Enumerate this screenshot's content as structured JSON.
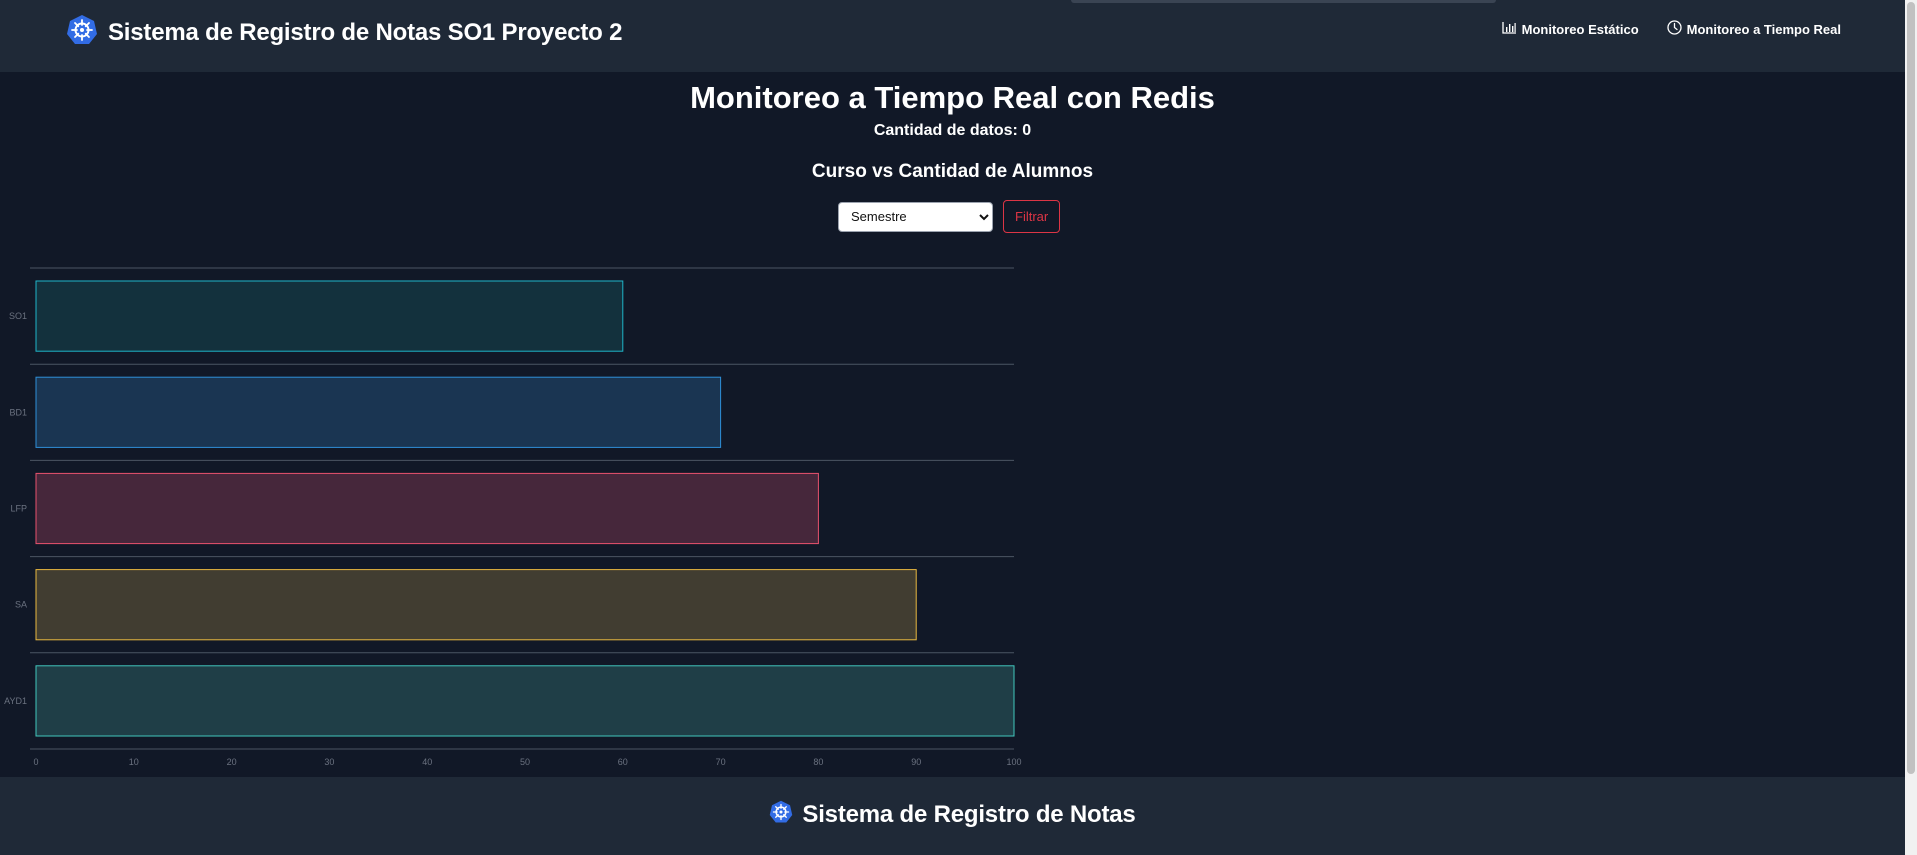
{
  "header": {
    "brand_icon": "kubernetes-helm-icon",
    "title": "Sistema de Registro de Notas SO1 Proyecto 2",
    "nav": [
      {
        "icon": "bar-chart-icon",
        "label": "Monitoreo Estático"
      },
      {
        "icon": "clock-icon",
        "label": "Monitoreo a Tiempo Real"
      }
    ]
  },
  "main": {
    "title": "Monitoreo a Tiempo Real con Redis",
    "data_count": "Cantidad de datos: 0",
    "chart_title": "Curso vs Cantidad de Alumnos",
    "filter": {
      "select_value": "Semestre",
      "button_label": "Filtrar"
    }
  },
  "chart_data": {
    "type": "bar",
    "orientation": "horizontal",
    "categories": [
      "SO1",
      "BD1",
      "LFP",
      "SA",
      "AYD1"
    ],
    "values": [
      60,
      70,
      80,
      90,
      100
    ],
    "xlim": [
      0,
      100
    ],
    "xticks": [
      "0",
      "10",
      "20",
      "30",
      "40",
      "50",
      "60",
      "70",
      "80",
      "90",
      "100"
    ],
    "colors": [
      {
        "fill": "#13313d",
        "stroke": "#1fb5c9"
      },
      {
        "fill": "#1a3552",
        "stroke": "#2f8fd8"
      },
      {
        "fill": "#46273b",
        "stroke": "#e8526e"
      },
      {
        "fill": "#413d31",
        "stroke": "#e9b940"
      },
      {
        "fill": "#1f3e47",
        "stroke": "#41c7bc"
      }
    ],
    "grid": "horizontal",
    "legend": "none"
  },
  "footer": {
    "brand_icon": "kubernetes-helm-icon",
    "title": "Sistema de Registro de Notas"
  },
  "colors": {
    "page_bg": "#111827",
    "bar_bg": "#1f2937",
    "accent_blue": "#326ce5",
    "danger": "#dc3545",
    "grid": "#4b5563",
    "tick_text": "#6b7280"
  }
}
